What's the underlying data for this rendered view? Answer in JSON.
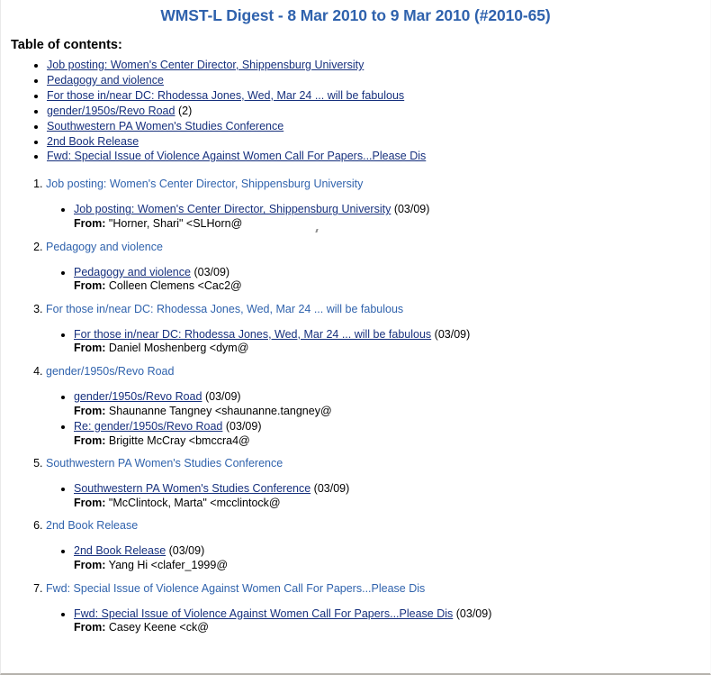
{
  "page": {
    "title": "WMST-L Digest - 8 Mar 2010 to 9 Mar 2010 (#2010-65)",
    "toc_heading": "Table of contents:",
    "link_color": "#16307d",
    "title_color": "#2f62ad",
    "section_title_color": "#3063ad",
    "background_color": "#ffffff"
  },
  "toc": {
    "items": [
      {
        "label": "Job posting: Women's Center Director, Shippensburg University",
        "count": ""
      },
      {
        "label": "Pedagogy and violence",
        "count": ""
      },
      {
        "label": "For those in/near DC: Rhodessa Jones, Wed, Mar 24 ... will be fabulous",
        "count": ""
      },
      {
        "label": "gender/1950s/Revo Road",
        "count": "(2)"
      },
      {
        "label": "Southwestern PA Women's Studies Conference",
        "count": ""
      },
      {
        "label": "2nd Book Release",
        "count": ""
      },
      {
        "label": "Fwd: Special Issue of Violence Against Women Call For Papers...Please Dis",
        "count": ""
      }
    ]
  },
  "sections": [
    {
      "number": "1.",
      "title": "Job posting: Women's Center Director, Shippensburg University",
      "messages": [
        {
          "subject": "Job posting: Women's Center Director, Shippensburg University",
          "date": "(03/09)",
          "from_label": "From:",
          "from_value": "\"Horner, Shari\" <SLHorn@"
        }
      ]
    },
    {
      "number": "2.",
      "title": "Pedagogy and violence",
      "messages": [
        {
          "subject": "Pedagogy and violence",
          "date": "(03/09)",
          "from_label": "From:",
          "from_value": "Colleen Clemens <Cac2@"
        }
      ]
    },
    {
      "number": "3.",
      "title": "For those in/near DC: Rhodessa Jones, Wed, Mar 24 ... will be fabulous",
      "messages": [
        {
          "subject": "For those in/near DC: Rhodessa Jones, Wed, Mar 24 ... will be fabulous",
          "date": "(03/09)",
          "from_label": "From:",
          "from_value": "Daniel Moshenberg <dym@"
        }
      ]
    },
    {
      "number": "4.",
      "title": "gender/1950s/Revo Road",
      "messages": [
        {
          "subject": "gender/1950s/Revo Road",
          "date": "(03/09)",
          "from_label": "From:",
          "from_value": "Shaunanne Tangney <shaunanne.tangney@"
        },
        {
          "subject": "Re: gender/1950s/Revo Road",
          "date": "(03/09)",
          "from_label": "From:",
          "from_value": "Brigitte McCray <bmccra4@"
        }
      ]
    },
    {
      "number": "5.",
      "title": "Southwestern PA Women's Studies Conference",
      "messages": [
        {
          "subject": "Southwestern PA Women's Studies Conference",
          "date": "(03/09)",
          "from_label": "From:",
          "from_value": "\"McClintock, Marta\" <mcclintock@"
        }
      ]
    },
    {
      "number": "6.",
      "title": "2nd Book Release",
      "messages": [
        {
          "subject": "2nd Book Release",
          "date": "(03/09)",
          "from_label": "From:",
          "from_value": "Yang Hi <clafer_1999@"
        }
      ]
    },
    {
      "number": "7.",
      "title": "Fwd: Special Issue of Violence Against Women Call For Papers...Please Dis",
      "messages": [
        {
          "subject": "Fwd: Special Issue of Violence Against Women Call For Papers...Please Dis",
          "date": "(03/09)",
          "from_label": "From:",
          "from_value": "Casey Keene <ck@"
        }
      ]
    }
  ]
}
